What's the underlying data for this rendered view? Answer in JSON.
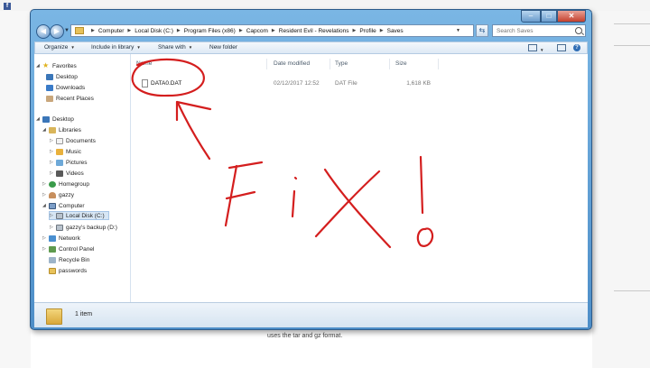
{
  "explorer": {
    "window_controls": {
      "minimize": "–",
      "maximize": "□",
      "close": "✕"
    },
    "address": {
      "crumbs": [
        "Computer",
        "Local Disk (C:)",
        "Program Files (x86)",
        "Capcom",
        "Resident Evil - Revelations",
        "Profile",
        "Saves"
      ],
      "search_placeholder": "Search Saves"
    },
    "toolbar": {
      "organize": "Organize",
      "include_in_library": "Include in library",
      "share_with": "Share with",
      "new_folder": "New folder"
    },
    "nav": {
      "favorites": "Favorites",
      "desktop_fav": "Desktop",
      "downloads": "Downloads",
      "recent_places": "Recent Places",
      "desktop": "Desktop",
      "libraries": "Libraries",
      "documents": "Documents",
      "music": "Music",
      "pictures": "Pictures",
      "videos": "Videos",
      "homegroup": "Homegroup",
      "gazzy": "gazzy",
      "computer": "Computer",
      "local_disk": "Local Disk (C:)",
      "backup": "gazzy's backup (D:)",
      "network": "Network",
      "control_panel": "Control Panel",
      "recycle_bin": "Recycle Bin",
      "passwords": "passwords"
    },
    "columns": {
      "name": "Name",
      "date_modified": "Date modified",
      "type": "Type",
      "size": "Size"
    },
    "files": [
      {
        "name": "DATA0.DAT",
        "date": "02/12/2017 12:52",
        "type": "DAT File",
        "size": "1,618 KB"
      }
    ],
    "status": {
      "item_count": "1 item"
    }
  },
  "background": {
    "caption": "uses the tar and gz format."
  },
  "annotation": {
    "text": "FiX!",
    "color": "#d41e1e"
  }
}
